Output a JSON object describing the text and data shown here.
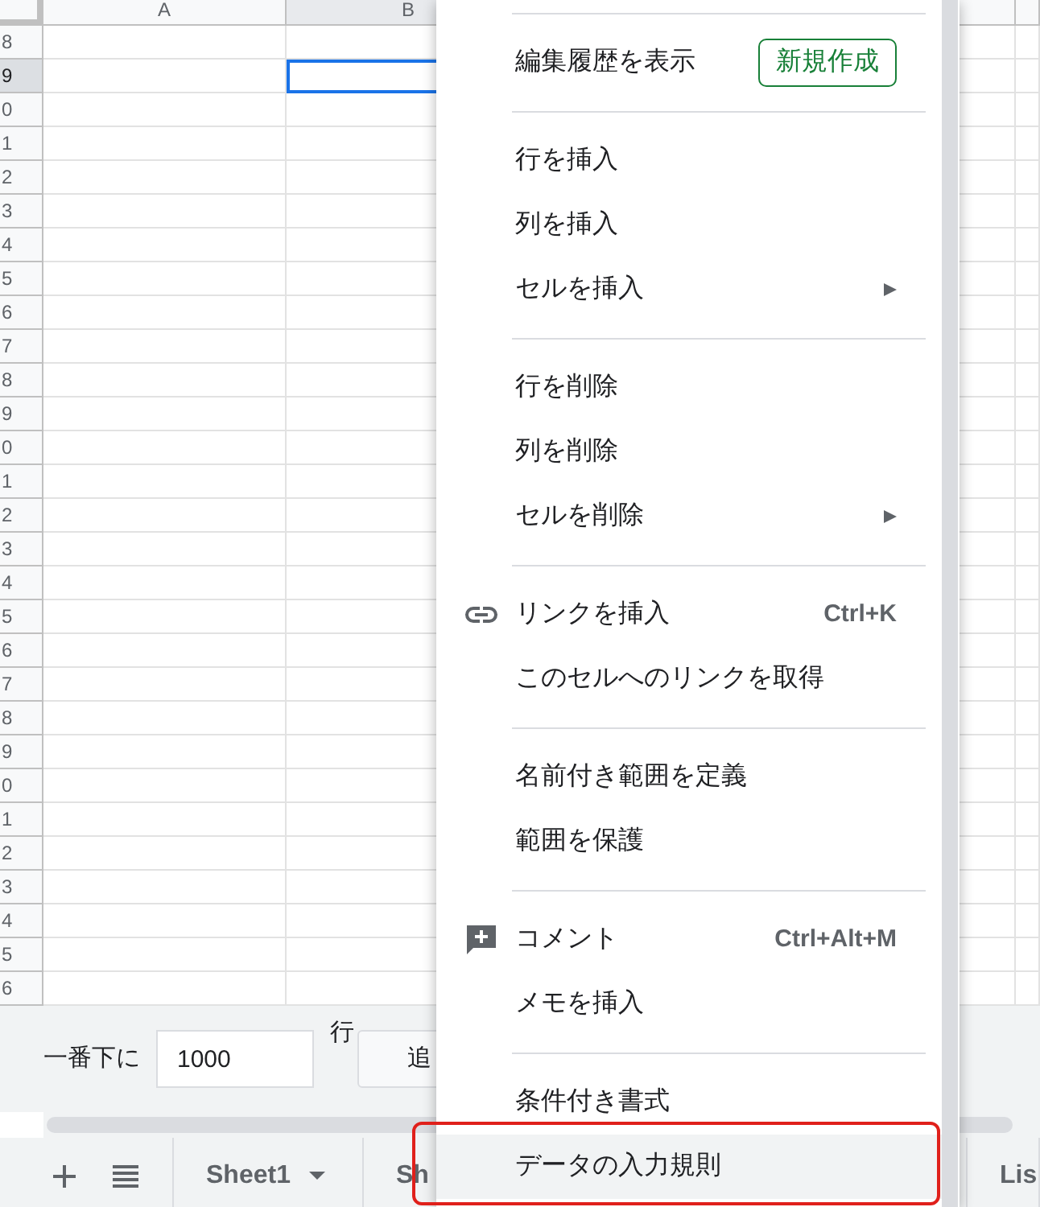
{
  "grid": {
    "columns": [
      {
        "label": "A",
        "selected": false
      },
      {
        "label": "B",
        "selected": true
      },
      {
        "selected": false
      },
      {
        "selected": false
      }
    ],
    "rows": [
      {
        "label": "8",
        "selected": false
      },
      {
        "label": "9",
        "selected": true
      },
      {
        "label": "0",
        "selected": false
      },
      {
        "label": "1",
        "selected": false
      },
      {
        "label": "2",
        "selected": false
      },
      {
        "label": "3",
        "selected": false
      },
      {
        "label": "4",
        "selected": false
      },
      {
        "label": "5",
        "selected": false
      },
      {
        "label": "6",
        "selected": false
      },
      {
        "label": "7",
        "selected": false
      },
      {
        "label": "8",
        "selected": false
      },
      {
        "label": "9",
        "selected": false
      },
      {
        "label": "0",
        "selected": false
      },
      {
        "label": "1",
        "selected": false
      },
      {
        "label": "2",
        "selected": false
      },
      {
        "label": "3",
        "selected": false
      },
      {
        "label": "4",
        "selected": false
      },
      {
        "label": "5",
        "selected": false
      },
      {
        "label": "6",
        "selected": false
      },
      {
        "label": "7",
        "selected": false
      },
      {
        "label": "8",
        "selected": false
      },
      {
        "label": "9",
        "selected": false
      },
      {
        "label": "0",
        "selected": false
      },
      {
        "label": "1",
        "selected": false
      },
      {
        "label": "2",
        "selected": false
      },
      {
        "label": "3",
        "selected": false
      },
      {
        "label": "4",
        "selected": false
      },
      {
        "label": "5",
        "selected": false
      },
      {
        "label": "6",
        "selected": false
      }
    ]
  },
  "add_rows": {
    "label": "一番下に",
    "value": "1000",
    "unit": "行",
    "button": "追"
  },
  "sheet_tabs": [
    {
      "label": "Sheet1",
      "dropdown": true
    },
    {
      "label": "Sh",
      "dropdown": false
    },
    {
      "label": "Lis",
      "dropdown": false
    }
  ],
  "context_menu": {
    "sections": [
      [
        {
          "label": "編集履歴を表示",
          "badge": "新規作成",
          "highlighted": false
        }
      ],
      [
        {
          "label": "行を挿入",
          "highlighted": false
        },
        {
          "label": "列を挿入",
          "highlighted": false
        },
        {
          "label": "セルを挿入",
          "submenu": true,
          "highlighted": false
        }
      ],
      [
        {
          "label": "行を削除",
          "highlighted": false
        },
        {
          "label": "列を削除",
          "highlighted": false
        },
        {
          "label": "セルを削除",
          "submenu": true,
          "highlighted": false
        }
      ],
      [
        {
          "label": "リンクを挿入",
          "kind": "link",
          "shortcut": "Ctrl+K",
          "highlighted": false
        },
        {
          "label": "このセルへのリンクを取得",
          "highlighted": false
        }
      ],
      [
        {
          "label": "名前付き範囲を定義",
          "highlighted": false
        },
        {
          "label": "範囲を保護",
          "highlighted": false
        }
      ],
      [
        {
          "label": "コメント",
          "kind": "comment",
          "shortcut": "Ctrl+Alt+M",
          "highlighted": false
        },
        {
          "label": "メモを挿入",
          "highlighted": false
        }
      ],
      [
        {
          "label": "条件付き書式",
          "highlighted": false
        },
        {
          "label": "データの入力規則",
          "highlighted": true
        }
      ]
    ]
  },
  "annotation": {
    "kind": "outline",
    "color": "#e0201b"
  }
}
